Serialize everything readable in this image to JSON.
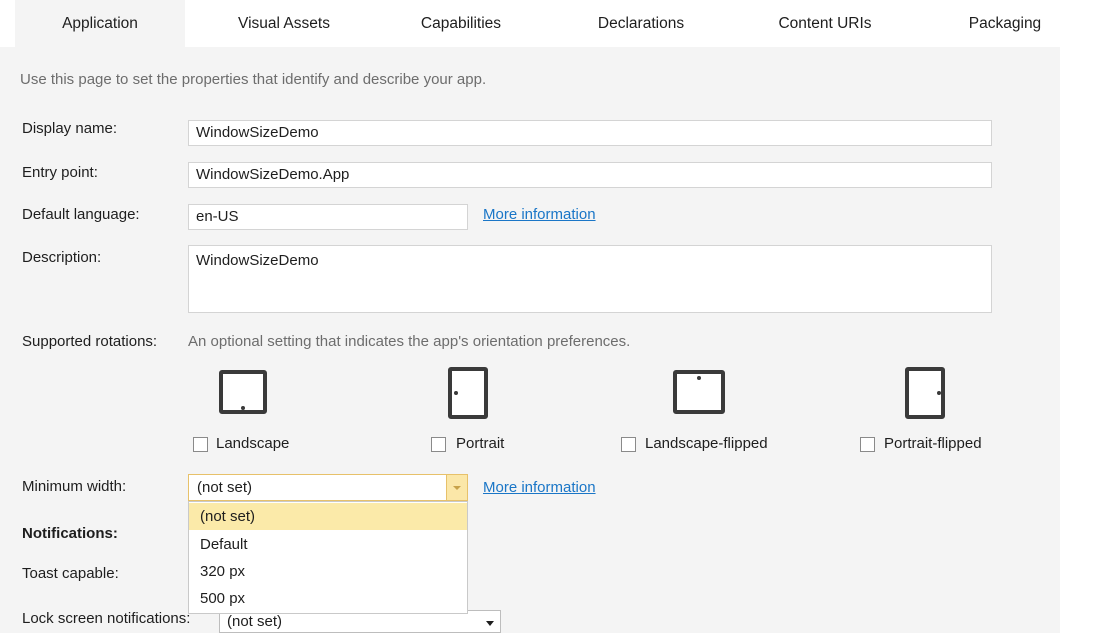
{
  "tabs": [
    {
      "label": "Application",
      "active": true
    },
    {
      "label": "Visual Assets"
    },
    {
      "label": "Capabilities"
    },
    {
      "label": "Declarations"
    },
    {
      "label": "Content URIs"
    },
    {
      "label": "Packaging"
    }
  ],
  "intro": "Use this page to set the properties that identify and describe your app.",
  "form": {
    "display_name": {
      "label": "Display name:",
      "value": "WindowSizeDemo"
    },
    "entry_point": {
      "label": "Entry point:",
      "value": "WindowSizeDemo.App"
    },
    "default_language": {
      "label": "Default language:",
      "value": "en-US",
      "link": "More information"
    },
    "description": {
      "label": "Description:",
      "value": "WindowSizeDemo"
    }
  },
  "rotations": {
    "label": "Supported rotations:",
    "hint": "An optional setting that indicates the app's orientation preferences.",
    "options": [
      {
        "label": "Landscape",
        "icon": "tablet-landscape-icon",
        "checked": false
      },
      {
        "label": "Portrait",
        "icon": "tablet-portrait-icon",
        "checked": false
      },
      {
        "label": "Landscape-flipped",
        "icon": "tablet-landscape-flipped-icon",
        "checked": false
      },
      {
        "label": "Portrait-flipped",
        "icon": "tablet-portrait-flipped-icon",
        "checked": false
      }
    ]
  },
  "minimum_width": {
    "label": "Minimum width:",
    "value": "(not set)",
    "link": "More information",
    "options": [
      "(not set)",
      "Default",
      "320 px",
      "500 px"
    ],
    "highlighted": "(not set)"
  },
  "notifications": {
    "heading": "Notifications:",
    "toast_label": "Toast capable:",
    "lock_label": "Lock screen notifications:",
    "lock_value": "(not set)"
  },
  "colors": {
    "accent_link": "#1a76c7",
    "dropdown_highlight": "#fbeaa9",
    "panel_bg": "#f4f4f4"
  }
}
